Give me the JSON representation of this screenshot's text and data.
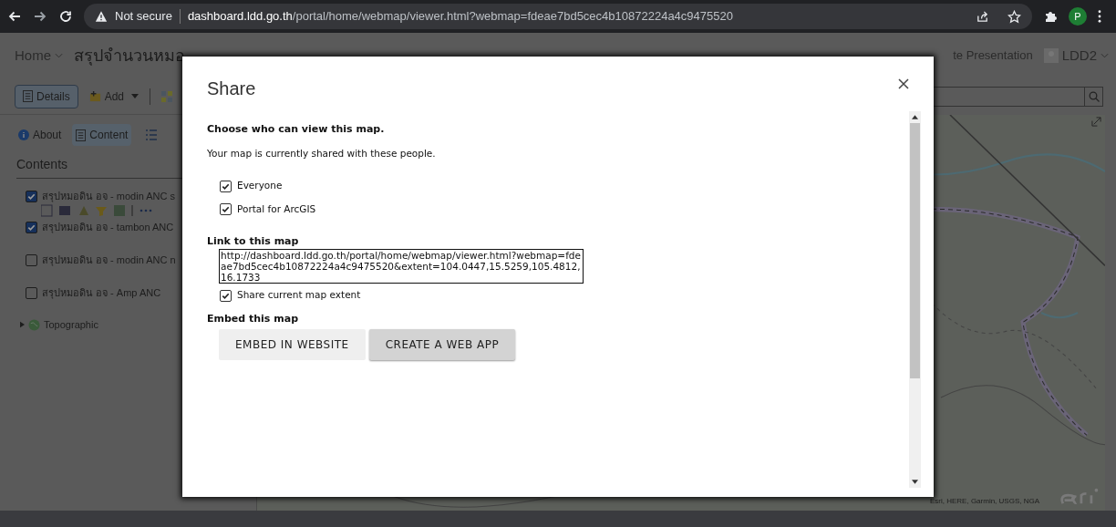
{
  "browser": {
    "not_secure_label": "Not secure",
    "url_host": "dashboard.ldd.go.th",
    "url_path": "/portal/home/webmap/viewer.html?webmap=fdeae7bd5cec4b10872224a4c9475520",
    "profile_initial": "P"
  },
  "app": {
    "home": "Home",
    "title": "สรุปจำนวนหมอ",
    "header_link": "te Presentation",
    "user": "LDD2",
    "toolbar": {
      "details": "Details",
      "add": "Add"
    },
    "tabs": [
      {
        "label": "About",
        "kind": "info",
        "selected": false
      },
      {
        "label": "Content",
        "kind": "content",
        "selected": true
      }
    ],
    "contents_heading": "Contents",
    "layers": [
      {
        "label": "สรุปหมอดิน อจ - modin ANC s",
        "checked": true,
        "expanded": true
      },
      {
        "label": "สรุปหมอดิน อจ - tambon ANC",
        "checked": true,
        "expanded": false
      },
      {
        "label": "สรุปหมอดิน อจ - modin ANC n",
        "checked": false,
        "expanded": false
      },
      {
        "label": "สรุปหมอดิน อจ - Amp ANC",
        "checked": false,
        "expanded": false
      }
    ],
    "basemap": "Topographic",
    "attribution": "Esri, HERE, Garmin, USGS, NGA"
  },
  "dialog": {
    "title": "Share",
    "heading": "Choose who can view this map.",
    "description": "Your map is currently shared with these people.",
    "options": [
      {
        "label": "Everyone",
        "checked": true
      },
      {
        "label": "Portal for ArcGIS",
        "checked": true
      }
    ],
    "link_heading": "Link to this map",
    "link_value": "http://dashboard.ldd.go.th/portal/home/webmap/viewer.html?webmap=fdeae7bd5cec4b10872224a4c9475520&extent=104.0447,15.5259,105.4812,16.1733",
    "extent": {
      "label": "Share current map extent",
      "checked": true
    },
    "embed_heading": "Embed this map",
    "buttons": [
      {
        "label": "EMBED IN WEBSITE",
        "selected": false
      },
      {
        "label": "CREATE A WEB APP",
        "selected": true
      }
    ]
  }
}
